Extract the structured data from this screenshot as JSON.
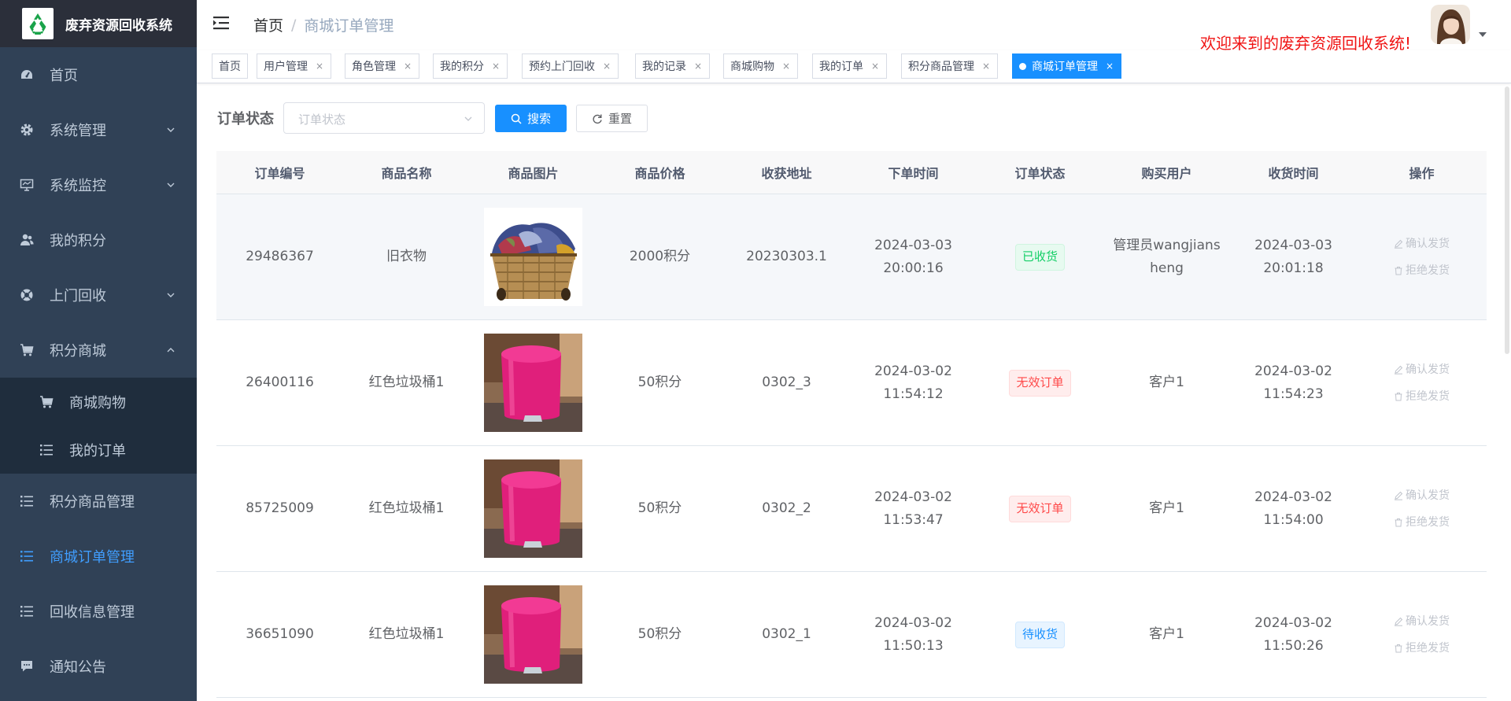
{
  "app": {
    "title": "废弃资源回收系统",
    "welcome": "欢迎来到的废弃资源回收系统!"
  },
  "sidebar": {
    "items": [
      {
        "label": "首页",
        "icon": "dashboard-icon"
      },
      {
        "label": "系统管理",
        "icon": "gear-icon"
      },
      {
        "label": "系统监控",
        "icon": "monitor-icon"
      },
      {
        "label": "我的积分",
        "icon": "peoples-icon"
      },
      {
        "label": "上门回收",
        "icon": "lifebuoy-icon"
      },
      {
        "label": "积分商城",
        "icon": "cart-icon"
      },
      {
        "label": "商城购物",
        "icon": "cart-icon"
      },
      {
        "label": "我的订单",
        "icon": "list-icon"
      },
      {
        "label": "积分商品管理",
        "icon": "list-icon"
      },
      {
        "label": "商城订单管理",
        "icon": "list-icon"
      },
      {
        "label": "回收信息管理",
        "icon": "list-icon"
      },
      {
        "label": "通知公告",
        "icon": "message-icon"
      }
    ]
  },
  "header": {
    "breadcrumb": {
      "home": "首页",
      "separator": "/",
      "current": "商城订单管理"
    }
  },
  "tabs": [
    {
      "label": "首页"
    },
    {
      "label": "用户管理",
      "close": "×"
    },
    {
      "label": "角色管理",
      "close": "×"
    },
    {
      "label": "我的积分",
      "close": "×"
    },
    {
      "label": "预约上门回收",
      "close": "×"
    },
    {
      "label": "我的记录",
      "close": "×"
    },
    {
      "label": "商城购物",
      "close": "×"
    },
    {
      "label": "我的订单",
      "close": "×"
    },
    {
      "label": "积分商品管理",
      "close": "×"
    },
    {
      "label": "商城订单管理",
      "close": "×"
    }
  ],
  "filter": {
    "label": "订单状态",
    "placeholder": "订单状态",
    "search_label": "搜索",
    "reset_label": "重置"
  },
  "table": {
    "columns": [
      "订单编号",
      "商品名称",
      "商品图片",
      "商品价格",
      "收获地址",
      "下单时间",
      "订单状态",
      "购买用户",
      "收货时间",
      "操作"
    ],
    "rows": [
      {
        "id": "29486367",
        "name": "旧衣物",
        "image": "clothes-basket",
        "price": "2000积分",
        "address": "20230303.1",
        "order_time": "2024-03-03 20:00:16",
        "status": "已收货",
        "status_type": "success",
        "user": "管理员wangjiansheng",
        "receive_time": "2024-03-03 20:01:18"
      },
      {
        "id": "26400116",
        "name": "红色垃圾桶1",
        "image": "pink-bin",
        "price": "50积分",
        "address": "0302_3",
        "order_time": "2024-03-02 11:54:12",
        "status": "无效订单",
        "status_type": "danger",
        "user": "客户1",
        "receive_time": "2024-03-02 11:54:23"
      },
      {
        "id": "85725009",
        "name": "红色垃圾桶1",
        "image": "pink-bin",
        "price": "50积分",
        "address": "0302_2",
        "order_time": "2024-03-02 11:53:47",
        "status": "无效订单",
        "status_type": "danger",
        "user": "客户1",
        "receive_time": "2024-03-02 11:54:00"
      },
      {
        "id": "36651090",
        "name": "红色垃圾桶1",
        "image": "pink-bin",
        "price": "50积分",
        "address": "0302_1",
        "order_time": "2024-03-02 11:50:13",
        "status": "待收货",
        "status_type": "info",
        "user": "客户1",
        "receive_time": "2024-03-02 11:50:26"
      }
    ],
    "ops": {
      "confirm": "确认发货",
      "reject": "拒绝发货"
    }
  }
}
